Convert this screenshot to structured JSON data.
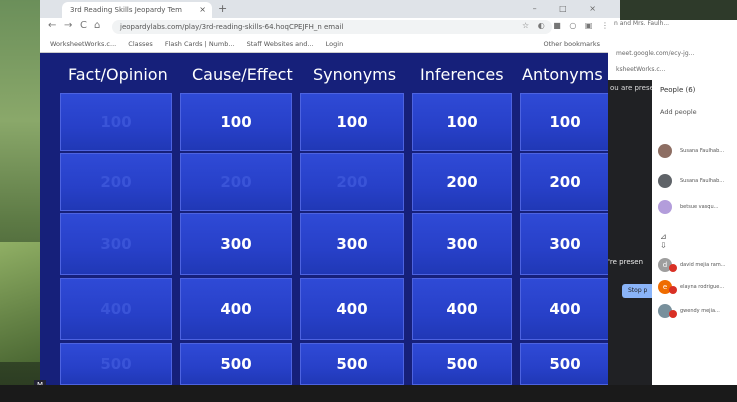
{
  "browser": {
    "tab_title": "3rd Reading Skills Jeopardy Tem",
    "tab_close": "×",
    "new_tab": "+",
    "window_controls": "– □ ×",
    "nav_back": "←",
    "nav_forward": "→",
    "nav_reload": "C",
    "nav_home": "⌂",
    "url": "jeopardylabs.com/play/3rd-reading-skills-64.hoqCPEJFH_n email",
    "toolbar_icons": "☆ ◐ ■ ○ ▣ ⋮",
    "bookmarks": [
      "WorksheetWorks.c...",
      "Classes",
      "Flash Cards | Numb...",
      "Staff Websites and...",
      "Login"
    ],
    "other_bookmarks": "Other bookmarks"
  },
  "board": {
    "categories": [
      "Fact/Opinion",
      "Cause/Effect",
      "Synonyms",
      "Inferences",
      "Antonyms"
    ],
    "columns": [
      {
        "cells": [
          {
            "value": "100",
            "used": true
          },
          {
            "value": "200",
            "used": true
          },
          {
            "value": "300",
            "used": true
          },
          {
            "value": "400",
            "used": true
          },
          {
            "value": "500",
            "used": true
          }
        ]
      },
      {
        "cells": [
          {
            "value": "100",
            "used": false
          },
          {
            "value": "200",
            "used": true
          },
          {
            "value": "300",
            "used": false
          },
          {
            "value": "400",
            "used": false
          },
          {
            "value": "500",
            "used": false
          }
        ]
      },
      {
        "cells": [
          {
            "value": "100",
            "used": false
          },
          {
            "value": "200",
            "used": true
          },
          {
            "value": "300",
            "used": false
          },
          {
            "value": "400",
            "used": false
          },
          {
            "value": "500",
            "used": false
          }
        ]
      },
      {
        "cells": [
          {
            "value": "100",
            "used": false
          },
          {
            "value": "200",
            "used": false
          },
          {
            "value": "300",
            "used": false
          },
          {
            "value": "400",
            "used": false
          },
          {
            "value": "500",
            "used": false
          }
        ]
      },
      {
        "cells": [
          {
            "value": "100",
            "used": false
          },
          {
            "value": "200",
            "used": false
          },
          {
            "value": "300",
            "used": false
          },
          {
            "value": "400",
            "used": false
          },
          {
            "value": "500",
            "used": false
          }
        ]
      }
    ],
    "badge": "M"
  },
  "meet": {
    "tab_title": "n and Mrs. Faulh...",
    "url": "meet.google.com/ecy-jg...",
    "bookmark": "ksheetWorks.c...",
    "presenting_top": "ou are prese",
    "presenting_text": "'re presen",
    "stop_button": "Stop p",
    "people_header": "People (6)",
    "add_people": "Add people",
    "participants": [
      {
        "initial": "",
        "name": "Susana Faulhab..."
      },
      {
        "initial": "",
        "name": "Susana Faulhab..."
      },
      {
        "initial": "",
        "name": "betsue vasqu..."
      },
      {
        "initial": "d",
        "name": "david mejia ram..."
      },
      {
        "initial": "e",
        "name": "elayna rodrigue..."
      },
      {
        "initial": "",
        "name": "gwendy mejia..."
      }
    ]
  },
  "colors": {
    "board_bg": "#16207a",
    "cell_blue": "#2f4ad6",
    "used_text": "#3a54d8"
  }
}
